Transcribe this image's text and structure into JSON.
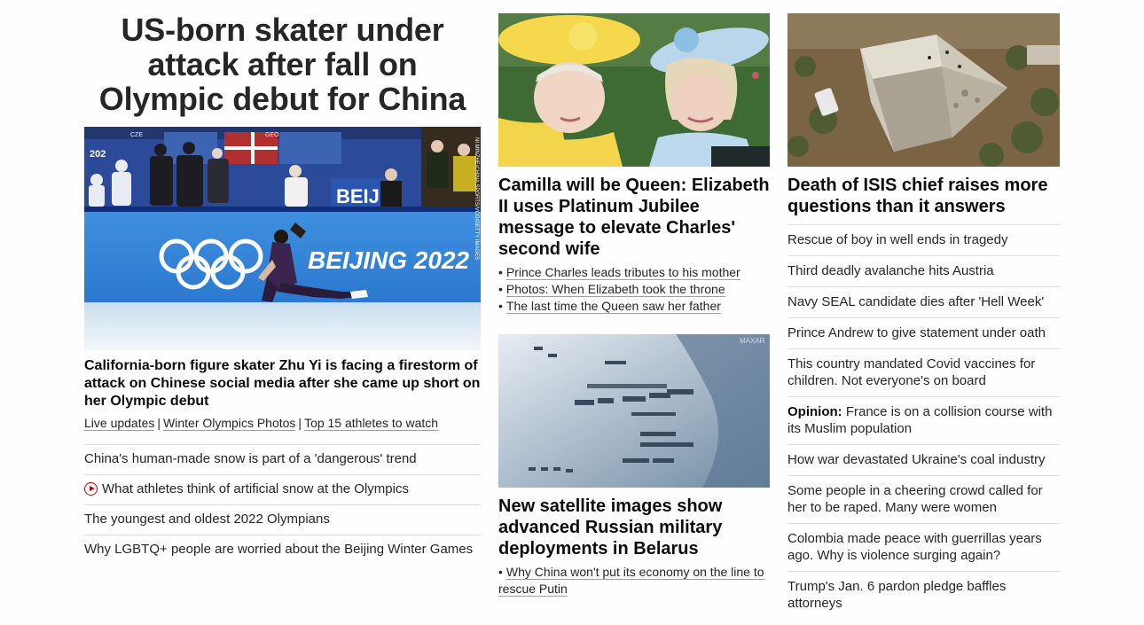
{
  "lead": {
    "title": "US-born skater under attack after fall on Olympic debut for China",
    "photo_credit": "NI MINZHE/CHINA SPORTS/VCG/GETTY IMAGES",
    "description": "California-born figure skater Zhu Yi is facing a firestorm of attack on Chinese social media after she came up short on her Olympic debut",
    "links": [
      "Live updates",
      "Winter Olympics Photos",
      "Top 15 athletes to watch"
    ],
    "separator": "|",
    "related": [
      {
        "text": "China's human-made snow is part of a 'dangerous' trend",
        "video": false
      },
      {
        "text": "What athletes think of artificial snow at the Olympics",
        "video": true
      },
      {
        "text": "The youngest and oldest 2022 Olympians",
        "video": false
      },
      {
        "text": "Why LGBTQ+ people are worried about the Beijing Winter Games",
        "video": false
      }
    ],
    "image": {
      "board_left": "CZE",
      "board_right": "GEO",
      "banner_text": "BEIJING 2022",
      "upper_text": "BEIJ",
      "side_text": "202"
    }
  },
  "middle": {
    "card1": {
      "title": "Camilla will be Queen: Elizabeth II uses Platinum Jubilee message to elevate Charles' second wife",
      "bullets": [
        "Prince Charles leads tributes to his mother",
        "Photos: When Elizabeth took the throne",
        "The last time the Queen saw her father"
      ]
    },
    "card2": {
      "image_watermark": "MAXAR",
      "title": "New satellite images show advanced Russian military deployments in Belarus",
      "bullets": [
        "Why China won't put its economy on the line to rescue Putin"
      ]
    },
    "bullet_char": "•"
  },
  "right": {
    "title": "Death of ISIS chief raises more questions than it answers",
    "list": [
      {
        "prefix": "",
        "text": "Rescue of boy in well ends in tragedy"
      },
      {
        "prefix": "",
        "text": "Third deadly avalanche hits Austria"
      },
      {
        "prefix": "",
        "text": "Navy SEAL candidate dies after 'Hell Week'"
      },
      {
        "prefix": "",
        "text": "Prince Andrew to give statement under oath"
      },
      {
        "prefix": "",
        "text": "This country mandated Covid vaccines for children. Not everyone's on board"
      },
      {
        "prefix": "Opinion:",
        "text": "France is on a collision course with its Muslim population"
      },
      {
        "prefix": "",
        "text": "How war devastated Ukraine's coal industry"
      },
      {
        "prefix": "",
        "text": "Some people in a cheering crowd called for her to be raped. Many were women"
      },
      {
        "prefix": "",
        "text": "Colombia made peace with guerrillas years ago. Why is violence surging again?"
      },
      {
        "prefix": "",
        "text": "Trump's Jan. 6 pardon pledge baffles attorneys"
      }
    ]
  },
  "colors": {
    "headline": "#0c0c0c",
    "video_icon": "#cc0000",
    "divider": "#dedede"
  }
}
